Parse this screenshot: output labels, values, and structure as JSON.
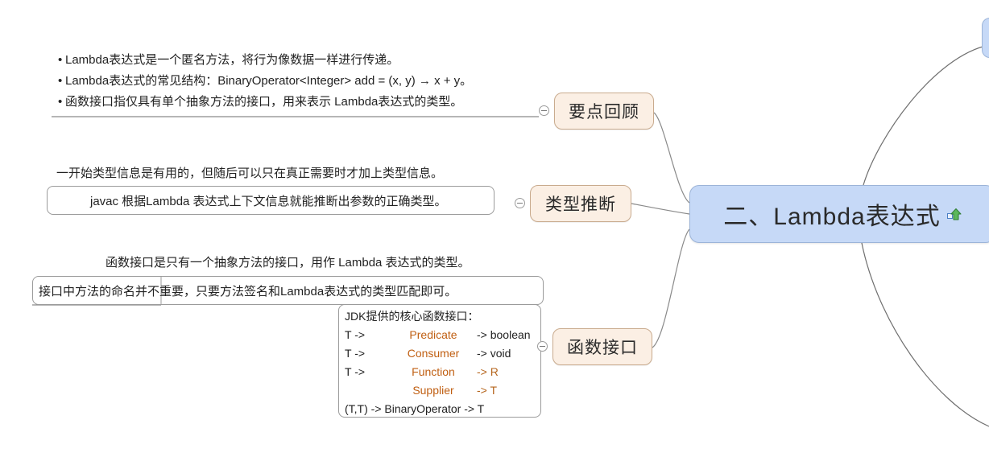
{
  "root": {
    "label": "二、Lambda表达式",
    "icon": "hyperlink-arrow-icon",
    "bg_color": "#c6d9f7",
    "border_color": "#9cb4d8"
  },
  "topics": [
    {
      "label": "要点回顾"
    },
    {
      "label": "类型推断"
    },
    {
      "label": "函数接口"
    }
  ],
  "topic_style": {
    "bg_color": "#fbefe4",
    "border_color": "#c9ab8e"
  },
  "branch1": {
    "bullets": [
      "Lambda表达式是一个匿名方法，将行为像数据一样进行传递。",
      "Lambda表达式的常见结构：BinaryOperator<Integer> add = (x, y) → x + y。",
      "函数接口指仅具有单个抽象方法的接口，用来表示 Lambda表达式的类型。"
    ],
    "bullet_char": "•"
  },
  "branch2": {
    "line1": "一开始类型信息是有用的，但随后可以只在真正需要时才加上类型信息。",
    "line2": "javac 根据Lambda 表达式上下文信息就能推断出参数的正确类型。"
  },
  "branch3": {
    "line1": "函数接口是只有一个抽象方法的接口，用作 Lambda 表达式的类型。",
    "line2": "接口中方法的命名并不重要，只要方法签名和Lambda表达式的类型匹配即可。"
  },
  "jdk_table": {
    "title": "JDK提供的核心函数接口：",
    "rows": [
      {
        "input": "T ->",
        "name": "Predicate",
        "output": "-> boolean"
      },
      {
        "input": "T ->",
        "name": "Consumer",
        "output": "-> void"
      },
      {
        "input": "T ->",
        "name": "Function",
        "output": "-> R"
      },
      {
        "input": "",
        "name": "Supplier",
        "output": "-> T"
      }
    ],
    "last_row": "(T,T) -> BinaryOperator -> T"
  },
  "toggles": {
    "symbol": "−",
    "state": "collapse"
  }
}
